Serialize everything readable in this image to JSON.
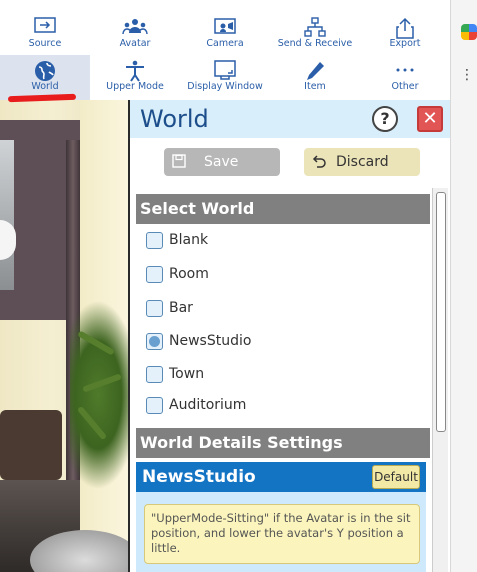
{
  "toolbar": {
    "row1": [
      {
        "label": "Source",
        "icon": "source-icon"
      },
      {
        "label": "Avatar",
        "icon": "avatar-icon"
      },
      {
        "label": "Camera",
        "icon": "camera-icon"
      },
      {
        "label": "Send & Receive",
        "icon": "network-icon"
      },
      {
        "label": "Export",
        "icon": "export-icon"
      }
    ],
    "row2": [
      {
        "label": "World",
        "icon": "globe-icon",
        "active": true
      },
      {
        "label": "Upper Mode",
        "icon": "person-icon"
      },
      {
        "label": "Display Window",
        "icon": "window-icon"
      },
      {
        "label": "Item",
        "icon": "pen-icon"
      },
      {
        "label": "Other",
        "icon": "more-icon"
      }
    ]
  },
  "panel": {
    "title": "World",
    "help_label": "?",
    "close_label": "✕",
    "save_label": "Save",
    "discard_label": "Discard"
  },
  "select_world": {
    "header": "Select World",
    "options": [
      {
        "label": "Blank",
        "checked": false
      },
      {
        "label": "Room",
        "checked": false
      },
      {
        "label": "Bar",
        "checked": false
      },
      {
        "label": "NewsStudio",
        "checked": true
      },
      {
        "label": "Town",
        "checked": false
      },
      {
        "label": "Auditorium",
        "checked": false
      }
    ]
  },
  "details": {
    "header": "World Details  Settings",
    "world_name": "NewsStudio",
    "default_label": "Default",
    "tip": "\"UpperMode-Sitting\" if the Avatar is in the sit position, and lower the avatar's Y position a little."
  },
  "colors": {
    "accent": "#1474c4",
    "title_blue": "#1d4e8c",
    "close_red": "#e25555",
    "underline_red": "#e81c1c"
  }
}
